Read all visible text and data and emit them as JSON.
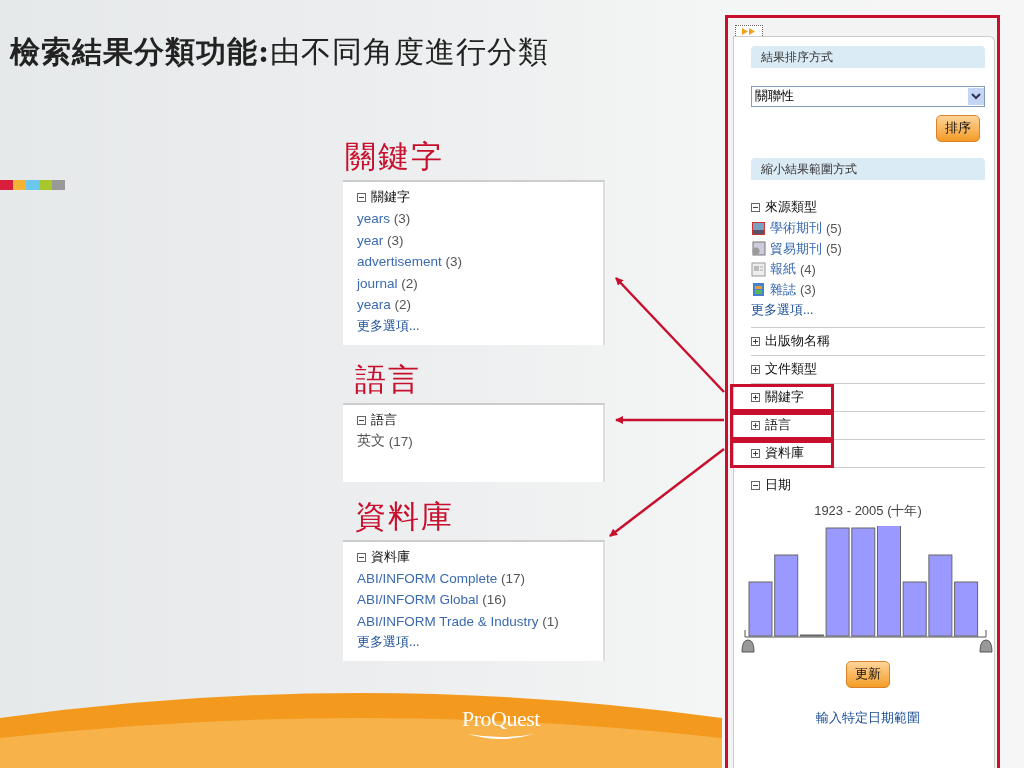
{
  "slide": {
    "title": "**檢索結果分類功能:**由不同角度進行分類",
    "logo": "ProQuest"
  },
  "callouts": [
    {
      "heading": "關鍵字",
      "facet": {
        "label": "關鍵字",
        "expanded": true,
        "items": [
          {
            "kind": "link",
            "label": "years",
            "count": "(3)"
          },
          {
            "kind": "link",
            "label": "year",
            "count": "(3)"
          },
          {
            "kind": "link",
            "label": "advertisement",
            "count": "(3)"
          },
          {
            "kind": "link",
            "label": "journal",
            "count": "(2)"
          },
          {
            "kind": "link",
            "label": "yeara",
            "count": "(2)"
          }
        ],
        "more": "更多選項..."
      }
    },
    {
      "heading": "語言",
      "facet": {
        "label": "語言",
        "expanded": true,
        "items": [
          {
            "kind": "text",
            "label": "英文",
            "count": "(17)"
          }
        ]
      }
    },
    {
      "heading": "資料庫",
      "facet": {
        "label": "資料庫",
        "expanded": true,
        "items": [
          {
            "kind": "link",
            "label": "ABI/INFORM Complete",
            "count": "(17)"
          },
          {
            "kind": "link",
            "label": "ABI/INFORM Global",
            "count": "(16)"
          },
          {
            "kind": "link",
            "label": "ABI/INFORM Trade & Industry",
            "count": "(1)"
          }
        ],
        "more": "更多選項..."
      }
    }
  ],
  "sidebar": {
    "toggle": {
      "focused": true
    },
    "sort_heading": "結果排序方式",
    "sort_select": {
      "value": "關聯性"
    },
    "sort_button": "排序",
    "narrow_heading": "縮小結果範圍方式",
    "source_type": {
      "label": "來源類型",
      "expanded": true,
      "items": [
        {
          "label": "學術期刊",
          "count": "(5)"
        },
        {
          "label": "貿易期刊",
          "count": "(5)"
        },
        {
          "label": "報紙",
          "count": "(4)"
        },
        {
          "label": "雜誌",
          "count": "(3)"
        }
      ],
      "more": "更多選項..."
    },
    "facets": [
      {
        "label": "出版物名稱",
        "expanded": false,
        "highlighted": false
      },
      {
        "label": "文件類型",
        "expanded": false,
        "highlighted": false
      },
      {
        "label": "關鍵字",
        "expanded": false,
        "highlighted": true
      },
      {
        "label": "語言",
        "expanded": false,
        "highlighted": true
      },
      {
        "label": "資料庫",
        "expanded": false,
        "highlighted": true
      }
    ],
    "date": {
      "label": "日期",
      "expanded": true,
      "range": "1923 - 2005 (十年)",
      "update_button": "更新",
      "specific_link": "輸入特定日期範圍"
    }
  }
}
